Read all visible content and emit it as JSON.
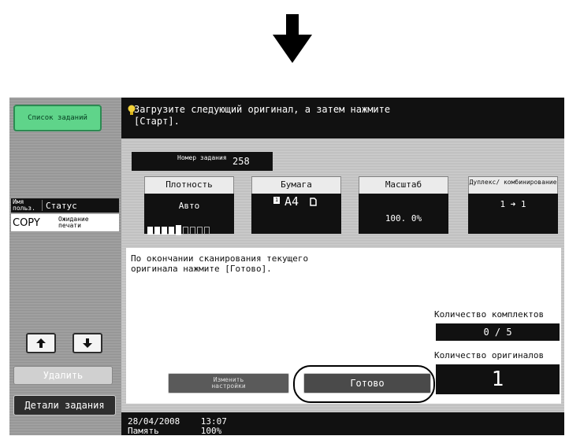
{
  "sidebar": {
    "job_list_label": "Список заданий",
    "col_user": "Имя польз.",
    "col_status": "Статус",
    "job": {
      "user": "COPY",
      "status": "Ожидание печати"
    },
    "delete_label": "Удалить",
    "details_label": "Детали задания"
  },
  "message": "Загрузите следующий оригинал, а затем нажмите [Старт].",
  "job_number": {
    "label": "Номер задания",
    "value": "258"
  },
  "settings": {
    "density": {
      "label": "Плотность",
      "value": "Авто",
      "level": 5,
      "steps": 9
    },
    "paper": {
      "label": "Бумага",
      "tray": "1",
      "value": "A4",
      "orientation_icon": "portrait-page-icon"
    },
    "zoom": {
      "label": "Масштаб",
      "value": "100. 0%"
    },
    "duplex": {
      "label": "Дуплекс/ комбинирование",
      "value": "1 ➜ 1"
    }
  },
  "instruction": "По окончании сканирования текущего оригинала нажмите [Готово].",
  "sets": {
    "label": "Количество комплектов",
    "value": "0 / 5"
  },
  "originals": {
    "label": "Количество оригиналов",
    "value": "1"
  },
  "buttons": {
    "change_settings": "Изменить настройки",
    "done": "Готово"
  },
  "footer": {
    "date": "28/04/2008",
    "time": "13:07",
    "line2_label": "Память",
    "line2_value": "100%"
  },
  "colors": {
    "accent_green": "#5fd48a",
    "screen_black": "#111111"
  }
}
